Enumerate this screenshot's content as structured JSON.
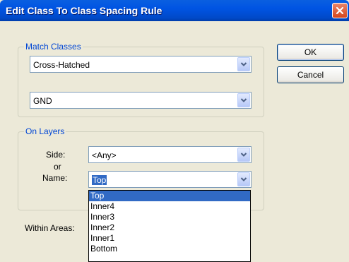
{
  "window": {
    "title": "Edit Class To Class Spacing Rule"
  },
  "match_classes": {
    "label": "Match Classes",
    "class1": "Cross-Hatched",
    "class2": "GND"
  },
  "on_layers": {
    "label": "On Layers",
    "side_label": "Side:",
    "or_label": "or",
    "name_label": "Name:",
    "side_value": "<Any>",
    "name_value": "Top"
  },
  "buttons": {
    "ok": "OK",
    "cancel": "Cancel"
  },
  "within_areas_label": "Within Areas:",
  "name_dropdown": {
    "options": [
      "Top",
      "Inner4",
      "Inner3",
      "Inner2",
      "Inner1",
      "Bottom"
    ],
    "selected": "Top"
  },
  "icons": {
    "close": "close-icon",
    "dropdown": "chevron-down-icon"
  },
  "colors": {
    "titlebar": "#0054e3",
    "accent_label": "#0046d5",
    "selection": "#316ac5",
    "close": "#d6451c"
  }
}
